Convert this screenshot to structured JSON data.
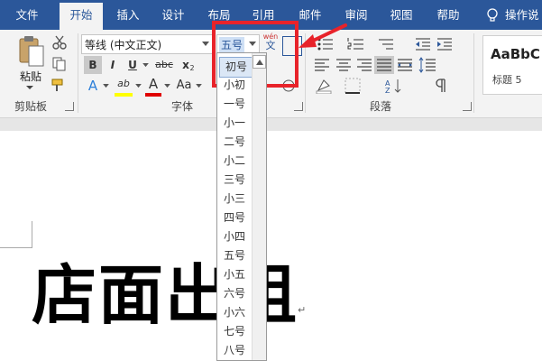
{
  "tabs": [
    {
      "label": "文件"
    },
    {
      "label": "开始",
      "active": true
    },
    {
      "label": "插入"
    },
    {
      "label": "设计"
    },
    {
      "label": "布局"
    },
    {
      "label": "引用"
    },
    {
      "label": "邮件"
    },
    {
      "label": "审阅"
    },
    {
      "label": "视图"
    },
    {
      "label": "帮助"
    }
  ],
  "tell_me": "操作说",
  "clipboard": {
    "paste_label": "粘贴",
    "group_label": "剪贴板"
  },
  "font": {
    "name_value": "等线 (中文正文)",
    "size_value": "五号",
    "phonetic_top": "wén",
    "phonetic_bottom": "文",
    "bold": "B",
    "italic": "I",
    "underline": "U",
    "strike": "abc",
    "subscript": "x",
    "superscript": "2",
    "effect": "A",
    "highlight": "ab",
    "color": "A",
    "case": "Aa",
    "group_label": "字体"
  },
  "paragraph": {
    "group_label": "段落"
  },
  "styles": {
    "preview": "AaBbC",
    "name": "标题 5"
  },
  "size_dropdown": {
    "selected": "初号",
    "items": [
      "初号",
      "小初",
      "一号",
      "小一",
      "二号",
      "小二",
      "三号",
      "小三",
      "四号",
      "小四",
      "五号",
      "小五",
      "六号",
      "小六",
      "七号",
      "八号"
    ]
  },
  "document": {
    "text": "店面出租",
    "pilcrow": "↵"
  },
  "colors": {
    "accent": "#2b579a",
    "annotation": "#e8232a",
    "highlight": "#ffff00",
    "font_color": "#e00000"
  }
}
